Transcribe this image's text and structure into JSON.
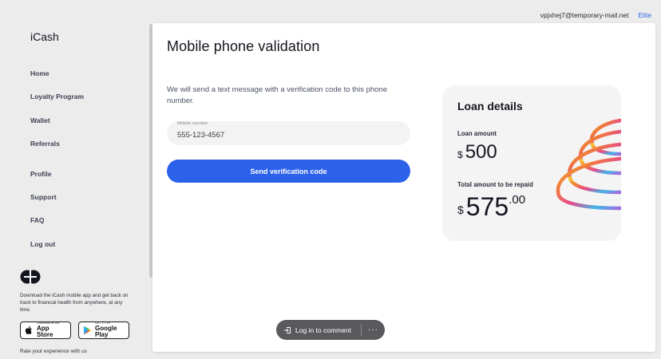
{
  "header": {
    "email": "vpjxhej7@temporary-mail.net",
    "tier": "Elite"
  },
  "sidebar": {
    "logo": "iCash",
    "nav": {
      "home": "Home",
      "loyalty": "Loyalty Program",
      "wallet": "Wallet",
      "referrals": "Referrals",
      "profile": "Profile",
      "support": "Support",
      "faq": "FAQ",
      "logout": "Log out"
    },
    "promo": {
      "text": "Download the iCash mobile app and get back on track to financial health from anywhere, at any time.",
      "app_store_small": "Download on the",
      "app_store_big": "App Store",
      "google_play_small": "GET IT ON",
      "google_play_big": "Google Play",
      "rate": "Rate your experience with us"
    }
  },
  "main": {
    "title": "Mobile phone validation",
    "intro": "We will send a text message with a verification code to this phone number.",
    "phone_label": "Mobile number",
    "phone_value": "555-123-4567",
    "send_button": "Send verification code"
  },
  "loan": {
    "title": "Loan details",
    "amount_label": "Loan amount",
    "currency": "$",
    "amount": "500",
    "total_label": "Total amount to be repaid",
    "total_whole": "575",
    "total_decimal": ".00"
  },
  "comment_bar": {
    "login": "Log in to comment",
    "more": "···"
  },
  "colors": {
    "accent": "#2c61ea",
    "tier_link": "#2f63f0"
  },
  "icons": [
    "icash-app-logo-icon",
    "apple-icon",
    "google-play-icon",
    "login-arrow-icon",
    "more-dots-icon",
    "rainbow-rings-graphic"
  ]
}
